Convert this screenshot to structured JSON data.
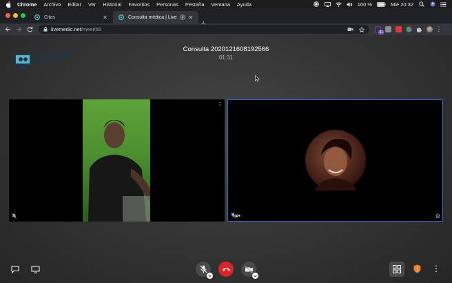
{
  "menubar": {
    "app": "Chrome",
    "items": [
      "Archivo",
      "Editar",
      "Ver",
      "Historial",
      "Favoritos",
      "Personas",
      "Pestaña",
      "Ventana",
      "Ayuda"
    ],
    "battery": "100 %",
    "clock": "Mié 20:32"
  },
  "tabs": [
    {
      "title": "Citas",
      "active": false
    },
    {
      "title": "Consulta médica | LiveMedic",
      "active": true
    }
  ],
  "address": {
    "host": "livemedic.net",
    "path": "/meet/66"
  },
  "extensions": {
    "calendar_badge": "31"
  },
  "page": {
    "logo_text_1": "LIVEMEDIC",
    "logo_text_2": "EDGLEY",
    "consulta_title": "Consulta 2020121608192566",
    "timer": "01:31"
  },
  "colors": {
    "active_tile_border": "#3b6ad6",
    "hangup": "#d9242a",
    "shield": "#e8822a"
  },
  "icons": [
    "chat-icon",
    "screen-share-icon",
    "mic-off-icon",
    "hangup-icon",
    "camera-off-icon",
    "grid-layout-icon",
    "shield-icon",
    "more-vert-icon"
  ]
}
